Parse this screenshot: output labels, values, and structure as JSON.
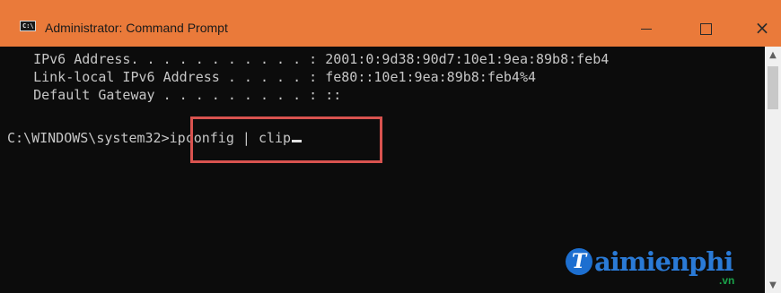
{
  "window": {
    "title": "Administrator: Command Prompt",
    "icon": "cmd-icon",
    "icon_text": "C:\\",
    "controls": {
      "minimize": "minimize-icon",
      "maximize": "maximize-icon",
      "close": "close-icon",
      "close_glyph": "×"
    }
  },
  "console": {
    "lines": [
      "   IPv6 Address. . . . . . . . . . . : 2001:0:9d38:90d7:10e1:9ea:89b8:feb4",
      "   Link-local IPv6 Address . . . . . : fe80::10e1:9ea:89b8:feb4%4",
      "   Default Gateway . . . . . . . . . : ::"
    ],
    "prompt": "C:\\WINDOWS\\system32>",
    "command": "ipconfig | clip"
  },
  "scrollbar": {
    "up_glyph": "▲",
    "down_glyph": "▼",
    "position": 0
  },
  "watermark": {
    "badge": "T",
    "text": "aimienphi",
    "sub": ".vn"
  },
  "colors": {
    "titlebar": "#ea7a3a",
    "console_bg": "#0c0c0c",
    "console_text": "#c6c6c6",
    "highlight_border": "#d9534f",
    "watermark_blue": "#2a7ad6",
    "watermark_green": "#1aa34a"
  }
}
